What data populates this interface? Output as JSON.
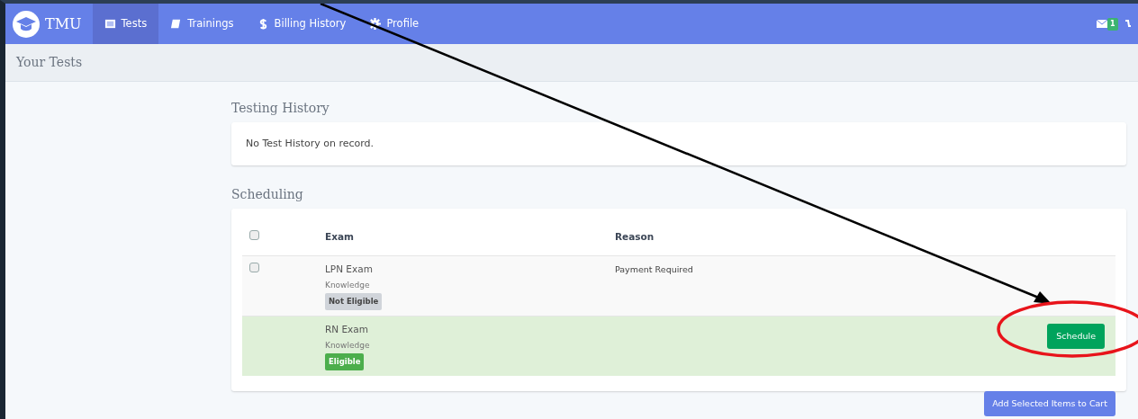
{
  "navbar": {
    "brand": "TMU",
    "items": [
      {
        "label": "Tests",
        "kind": "card",
        "selected": true
      },
      {
        "label": "Trainings",
        "kind": "book",
        "selected": false
      },
      {
        "label": "Billing History",
        "kind": "dollar",
        "selected": false
      },
      {
        "label": "Profile",
        "kind": "gear",
        "selected": false
      }
    ],
    "message_count": "1"
  },
  "page_title": "Your Tests",
  "testing_history": {
    "heading": "Testing History",
    "message": "No Test History on record."
  },
  "scheduling": {
    "heading": "Scheduling",
    "header_checkbox": {
      "checked": false
    },
    "columns": [
      "Exam",
      "Reason"
    ],
    "rows": [
      {
        "exam": "LPN Exam",
        "type": "Knowledge",
        "status": "Not Eligible",
        "eligible": false,
        "reason": "Payment Required",
        "checkbox": {
          "checked": false
        }
      },
      {
        "exam": "RN Exam",
        "type": "Knowledge",
        "status": "Eligible",
        "eligible": true,
        "action": "Schedule"
      }
    ],
    "cart_button": "Add Selected Items to Cart"
  },
  "annotations": [
    {
      "kind": "arrow"
    },
    {
      "kind": "ellipse"
    }
  ]
}
